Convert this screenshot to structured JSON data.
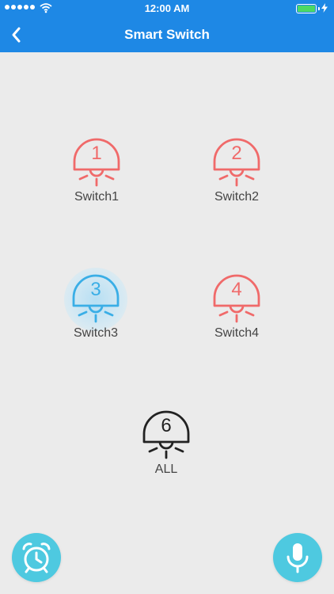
{
  "status_bar": {
    "time": "12:00 AM",
    "signal_dots": 5,
    "battery_level": 1.0
  },
  "header": {
    "title": "Smart Switch",
    "back_icon": "chevron-left-icon"
  },
  "switches": [
    {
      "number": "1",
      "label": "Switch1",
      "state": "off",
      "color": "#f06a6a"
    },
    {
      "number": "2",
      "label": "Switch2",
      "state": "off",
      "color": "#f06a6a"
    },
    {
      "number": "3",
      "label": "Switch3",
      "state": "on",
      "color": "#3aaee6"
    },
    {
      "number": "4",
      "label": "Switch4",
      "state": "off",
      "color": "#f06a6a"
    }
  ],
  "all_switch": {
    "number": "6",
    "label": "ALL",
    "color": "#222222"
  },
  "bottom": {
    "timer_icon": "alarm-clock-icon",
    "voice_icon": "microphone-icon"
  },
  "colors": {
    "header": "#1e88e5",
    "background": "#ebebeb",
    "fab": "#4ec9e0"
  }
}
